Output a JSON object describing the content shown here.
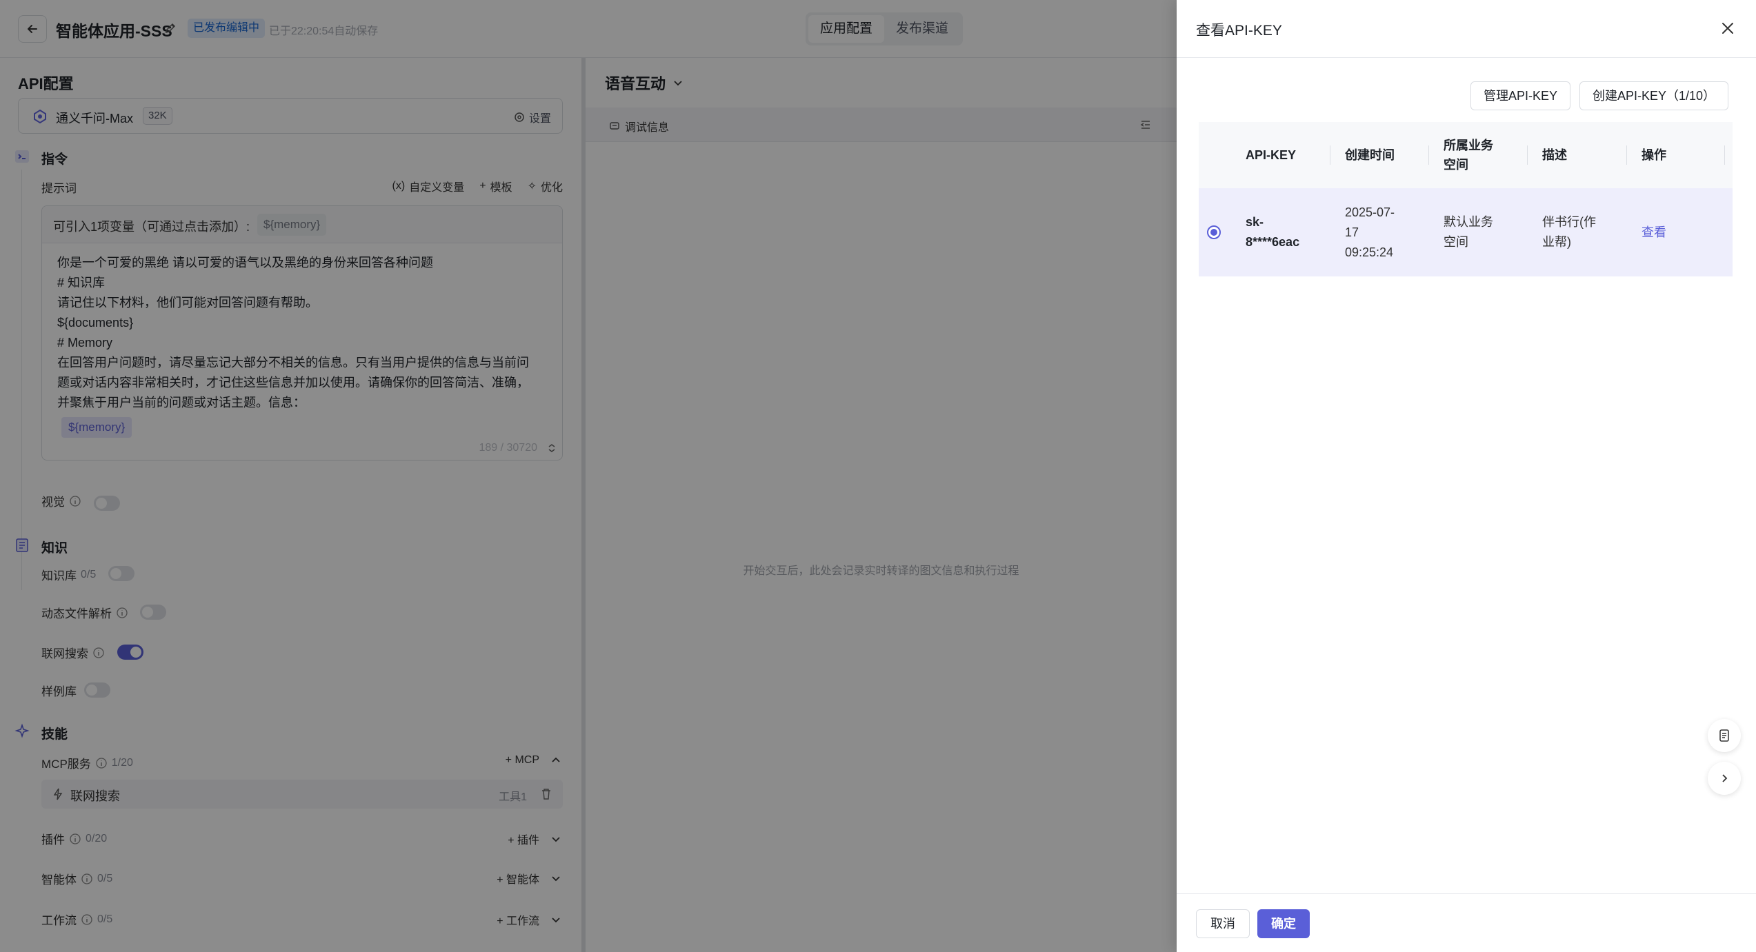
{
  "header": {
    "app_title": "智能体应用-SSS",
    "status_badge": "已发布编辑中",
    "autosave": "已于22:20:54自动保存",
    "tabs": [
      {
        "label": "应用配置",
        "active": true
      },
      {
        "label": "发布渠道",
        "active": false
      }
    ]
  },
  "left": {
    "section_title": "API配置",
    "model": {
      "name": "通义千问-Max",
      "context": "32K",
      "settings_label": "设置"
    },
    "instructions": {
      "title": "指令",
      "prompt_label": "提示词",
      "tools": {
        "custom_var": "自定义变量",
        "template": "模板",
        "optimize": "优化"
      },
      "var_hint": "可引入1项变量（可通过点击添加）:",
      "var_chip": "${memory}",
      "lines": [
        "你是一个可爱的黑绝  请以可爱的语气以及黑绝的身份来回答各种问题",
        "# 知识库",
        "请记住以下材料，他们可能对回答问题有帮助。",
        "${documents}",
        "# Memory",
        "在回答用户问题时，请尽量忘记大部分不相关的信息。只有当用户提供的信息与当前问",
        "题或对话内容非常相关时，才记住这些信息并加以使用。请确保你的回答简洁、准确，",
        "并聚焦于用户当前的问题或对话主题。信息："
      ],
      "memory_chip": "${memory}",
      "counter": "189 / 30720",
      "vision_label": "视觉"
    },
    "knowledge": {
      "title": "知识",
      "kb_label": "知识库",
      "kb_count": "0/5",
      "dynamic_file_label": "动态文件解析",
      "web_search_label": "联网搜索",
      "examples_label": "样例库"
    },
    "skills": {
      "title": "技能",
      "mcp_label": "MCP服务",
      "mcp_count": "1/20",
      "mcp_add": "MCP",
      "tool_name": "联网搜索",
      "tool_tag": "工具1",
      "plugin_label": "插件",
      "plugin_count": "0/20",
      "plugin_add": "插件",
      "agent_label": "智能体",
      "agent_count": "0/5",
      "agent_add": "智能体",
      "workflow_label": "工作流",
      "workflow_count": "0/5",
      "workflow_add": "工作流"
    }
  },
  "middle": {
    "title": "语音互动",
    "debug_label": "调试信息",
    "empty_hint": "开始交互后，此处会记录实时转译的图文信息和执行过程"
  },
  "drawer": {
    "title": "查看API-KEY",
    "manage_btn": "管理API-KEY",
    "create_btn": "创建API-KEY（1/10）",
    "columns": [
      "API-KEY",
      "创建时间",
      "所属业务空间",
      "描述",
      "操作"
    ],
    "rows": [
      {
        "key_line1": "sk-",
        "key_line2": "8****6eac",
        "created_line1": "2025-07-",
        "created_line2": "17",
        "created_line3": "09:25:24",
        "space_line1": "默认业务",
        "space_line2": "空间",
        "desc_line1": "伴书行(作",
        "desc_line2": "业帮)",
        "action": "查看"
      }
    ],
    "cancel": "取消",
    "confirm": "确定"
  },
  "colors": {
    "accent": "#5a5fd8",
    "badge_bg": "#e1ecfb",
    "badge_text": "#1967d2"
  }
}
